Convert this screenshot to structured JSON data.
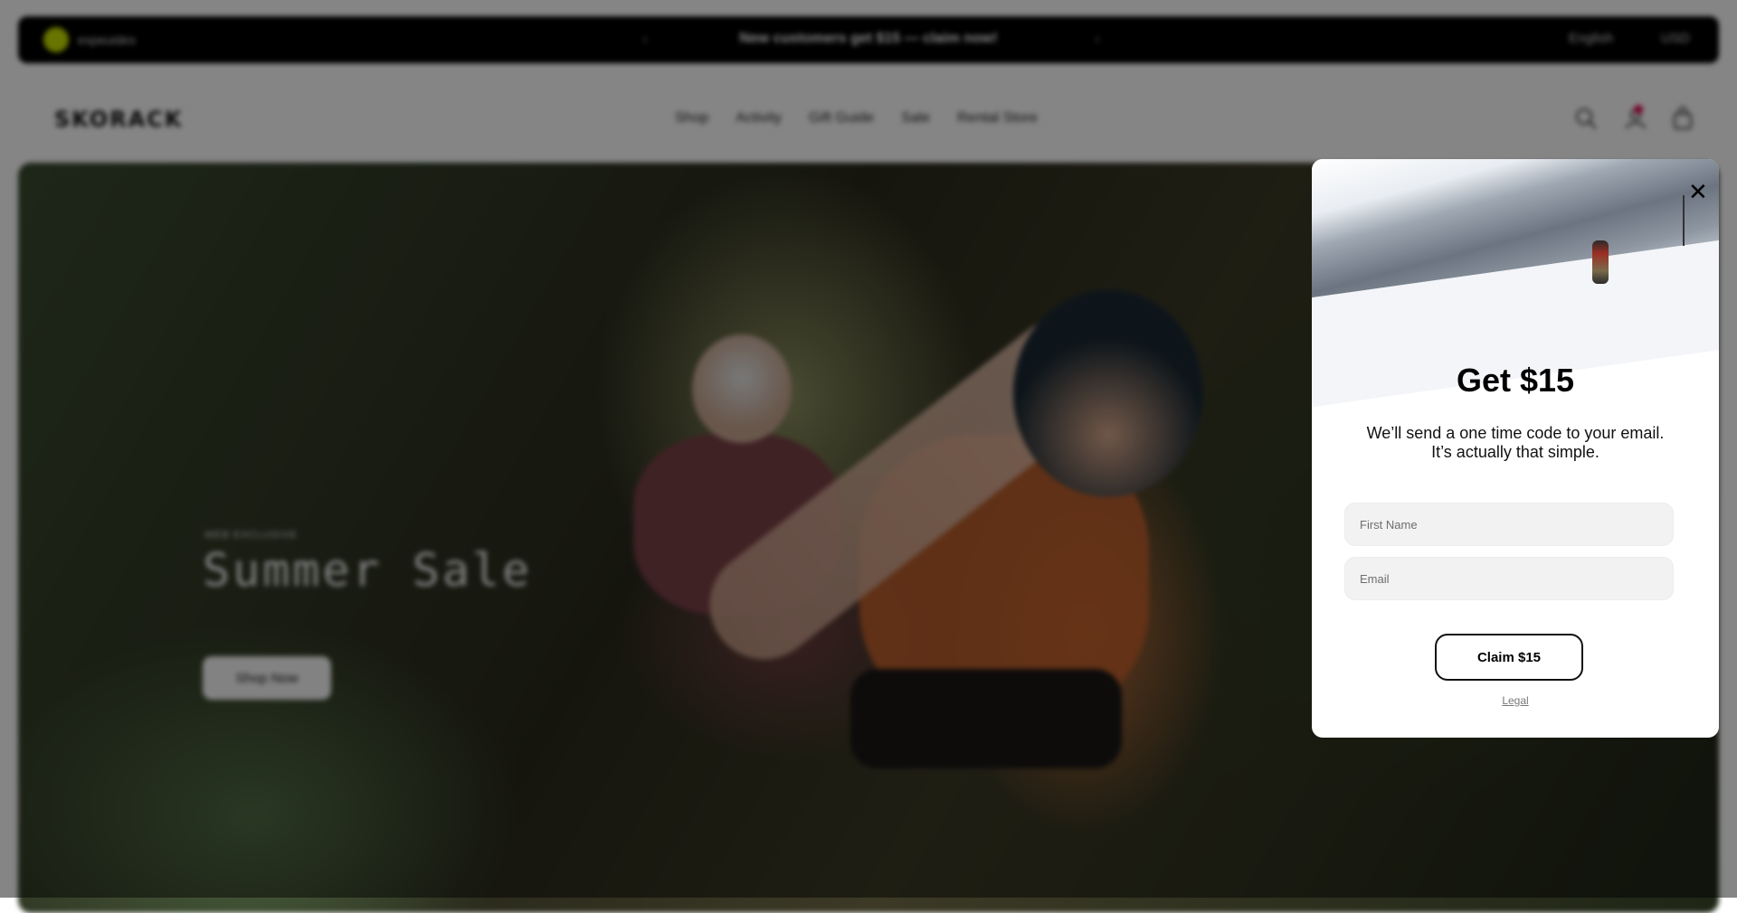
{
  "announcement": {
    "left_label": "expeuides",
    "message": "New customers get $15 — claim now!",
    "language": "English",
    "currency": "USD"
  },
  "header": {
    "logo": "SKORACK",
    "nav": [
      "Shop",
      "Activity",
      "Gift Guide",
      "Sale",
      "Rental Store"
    ]
  },
  "hero": {
    "eyebrow": "WEB EXCLUSIVE",
    "title": "Summer Sale",
    "button_label": "Shop Now"
  },
  "modal": {
    "title": "Get $15",
    "subtitle": "We’ll send a one time code to your email. It’s actually that simple.",
    "first_name_placeholder": "First Name",
    "email_placeholder": "Email",
    "claim_button": "Claim $15",
    "legal_link": "Legal",
    "close_glyph": "✕"
  },
  "icons": {
    "close": "close-icon",
    "search": "search-icon",
    "account": "account-icon",
    "bag": "bag-icon"
  },
  "colors": {
    "overlay": "#000000",
    "modal_bg": "#ffffff",
    "button_border": "#111111",
    "notification_dot": "#e0004d",
    "announcement_bg": "#000000"
  }
}
